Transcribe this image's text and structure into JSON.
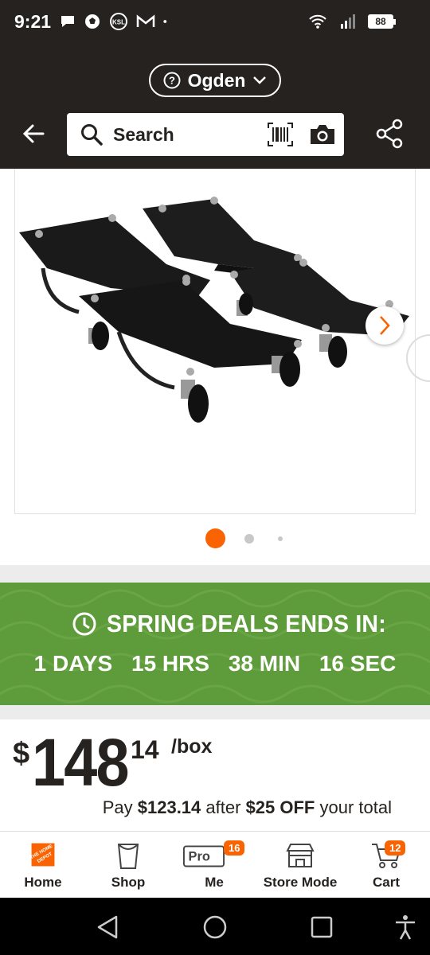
{
  "status_bar": {
    "time": "9:21",
    "battery": "88",
    "icons": [
      "chat-bubble-icon",
      "soccer-ball-icon",
      "ksl-icon",
      "gmail-icon",
      "dot-icon",
      "wifi-icon",
      "signal-icon",
      "battery-icon"
    ],
    "ksl_label": "KSL"
  },
  "header": {
    "store_name": "Ogden",
    "search_placeholder": "Search"
  },
  "gallery": {
    "image_count": 3,
    "active_index": 0
  },
  "promo": {
    "title": "SPRING DEALS ENDS IN:",
    "days": "1 DAYS",
    "hours": "15 HRS",
    "minutes": "38 MIN",
    "seconds": "16 SEC"
  },
  "price": {
    "currency": "$",
    "dollars": "148",
    "cents": "14",
    "unit": "/box",
    "pay_prefix": "Pay",
    "pay_amount": "$123.14",
    "pay_mid": "after",
    "discount": "$25 OFF",
    "pay_suffix": "your total"
  },
  "bottom_nav": {
    "items": [
      {
        "label": "Home",
        "icon": "home-depot-logo-icon"
      },
      {
        "label": "Shop",
        "icon": "bucket-icon"
      },
      {
        "label": "Me",
        "icon": "pro-card-icon",
        "badge": "16",
        "pro_text": "Pro"
      },
      {
        "label": "Store Mode",
        "icon": "store-icon"
      },
      {
        "label": "Cart",
        "icon": "cart-icon",
        "badge": "12"
      }
    ]
  },
  "colors": {
    "brand_orange": "#f96302",
    "header_dark": "#252220",
    "promo_green": "#5e9b3a"
  }
}
